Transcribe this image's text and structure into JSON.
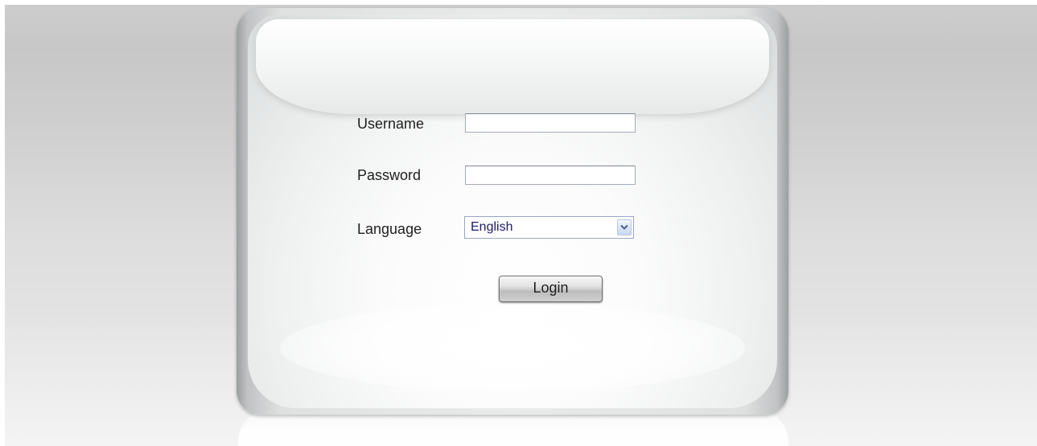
{
  "login_form": {
    "username_label": "Username",
    "username_value": "",
    "password_label": "Password",
    "password_value": "",
    "language_label": "Language",
    "language_selected": "English",
    "login_button_label": "Login"
  },
  "icons": {
    "select_arrow": "chevron-down-icon"
  },
  "colors": {
    "background": "#d3d3d3",
    "panel": "#f2f3f3",
    "select_text": "#1c1c6b",
    "select_border": "#98a7c5"
  }
}
